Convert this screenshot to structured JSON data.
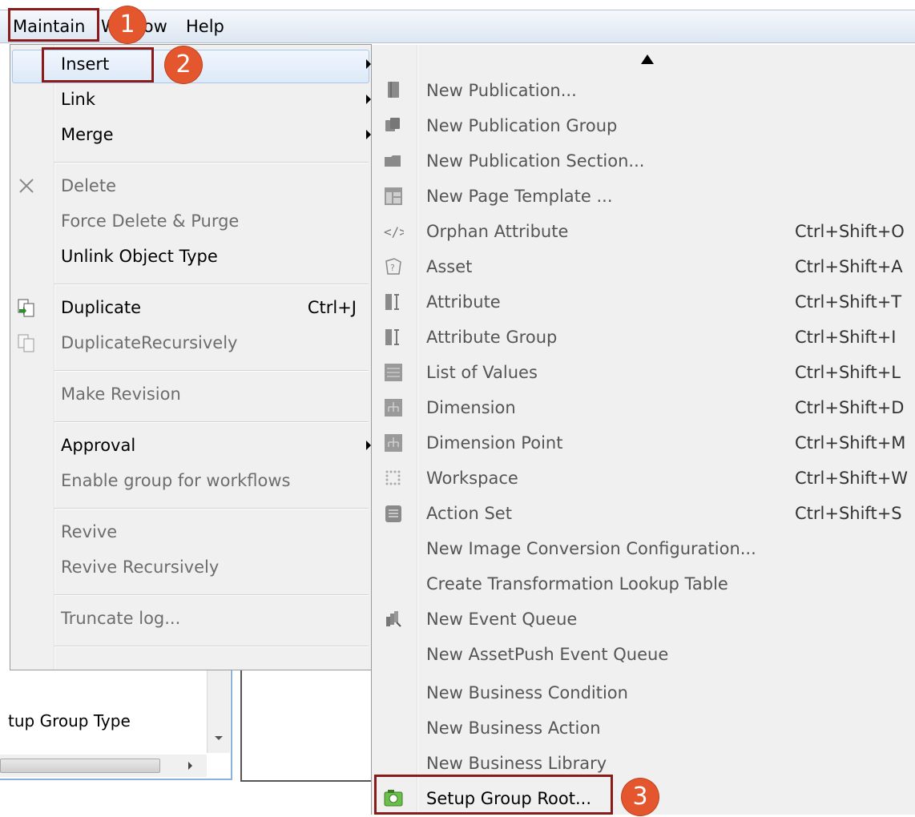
{
  "menubar": {
    "maintain": "Maintain",
    "window": "Window",
    "help": "Help"
  },
  "left_menu": {
    "insert": "Insert",
    "link": "Link",
    "merge": "Merge",
    "delete": "Delete",
    "force_delete": "Force Delete & Purge",
    "unlink_object_type": "Unlink Object Type",
    "duplicate": "Duplicate",
    "duplicate_shortcut": "Ctrl+J",
    "duplicate_recursively": "DuplicateRecursively",
    "make_revision": "Make Revision",
    "approval": "Approval",
    "enable_group": "Enable group for workflows",
    "revive": "Revive",
    "revive_recursively": "Revive Recursively",
    "truncate_log": "Truncate log..."
  },
  "submenu": {
    "items": [
      {
        "label": "New Publication...",
        "shortcut": "",
        "icon": "publication-icon"
      },
      {
        "label": "New Publication Group",
        "shortcut": "",
        "icon": "publication-group-icon"
      },
      {
        "label": "New Publication Section...",
        "shortcut": "",
        "icon": "publication-section-icon"
      },
      {
        "label": "New Page Template ...",
        "shortcut": "",
        "icon": "page-template-icon"
      },
      {
        "label": "Orphan Attribute",
        "shortcut": "Ctrl+Shift+O",
        "icon": "orphan-attribute-icon"
      },
      {
        "label": "Asset",
        "shortcut": "Ctrl+Shift+A",
        "icon": "asset-icon"
      },
      {
        "label": "Attribute",
        "shortcut": "Ctrl+Shift+T",
        "icon": "attribute-icon"
      },
      {
        "label": "Attribute Group",
        "shortcut": "Ctrl+Shift+I",
        "icon": "attribute-group-icon"
      },
      {
        "label": "List of Values",
        "shortcut": "Ctrl+Shift+L",
        "icon": "list-of-values-icon"
      },
      {
        "label": "Dimension",
        "shortcut": "Ctrl+Shift+D",
        "icon": "dimension-icon"
      },
      {
        "label": "Dimension Point",
        "shortcut": "Ctrl+Shift+M",
        "icon": "dimension-point-icon"
      },
      {
        "label": "Workspace",
        "shortcut": "Ctrl+Shift+W",
        "icon": "workspace-icon"
      },
      {
        "label": "Action Set",
        "shortcut": "Ctrl+Shift+S",
        "icon": "action-set-icon"
      },
      {
        "label": "New Image Conversion Configuration...",
        "shortcut": "",
        "icon": ""
      },
      {
        "label": "Create Transformation Lookup Table",
        "shortcut": "",
        "icon": ""
      },
      {
        "label": "New Event Queue",
        "shortcut": "",
        "icon": "event-queue-icon"
      },
      {
        "label": "New AssetPush Event Queue",
        "shortcut": "",
        "icon": ""
      },
      {
        "label": "New Business Condition",
        "shortcut": "",
        "icon": ""
      },
      {
        "label": "New Business Action",
        "shortcut": "",
        "icon": ""
      },
      {
        "label": "New Business Library",
        "shortcut": "",
        "icon": ""
      },
      {
        "label": "Setup Group Root...",
        "shortcut": "",
        "icon": "setup-group-root-icon"
      }
    ]
  },
  "lower": {
    "partial_label": "tup Group Type"
  },
  "callouts": {
    "one": "1",
    "two": "2",
    "three": "3"
  },
  "colors": {
    "callout_border": "#8b1a1a",
    "badge": "#e4572e",
    "menu_bg": "#f0f0f0",
    "hover": "#dde9f8"
  }
}
